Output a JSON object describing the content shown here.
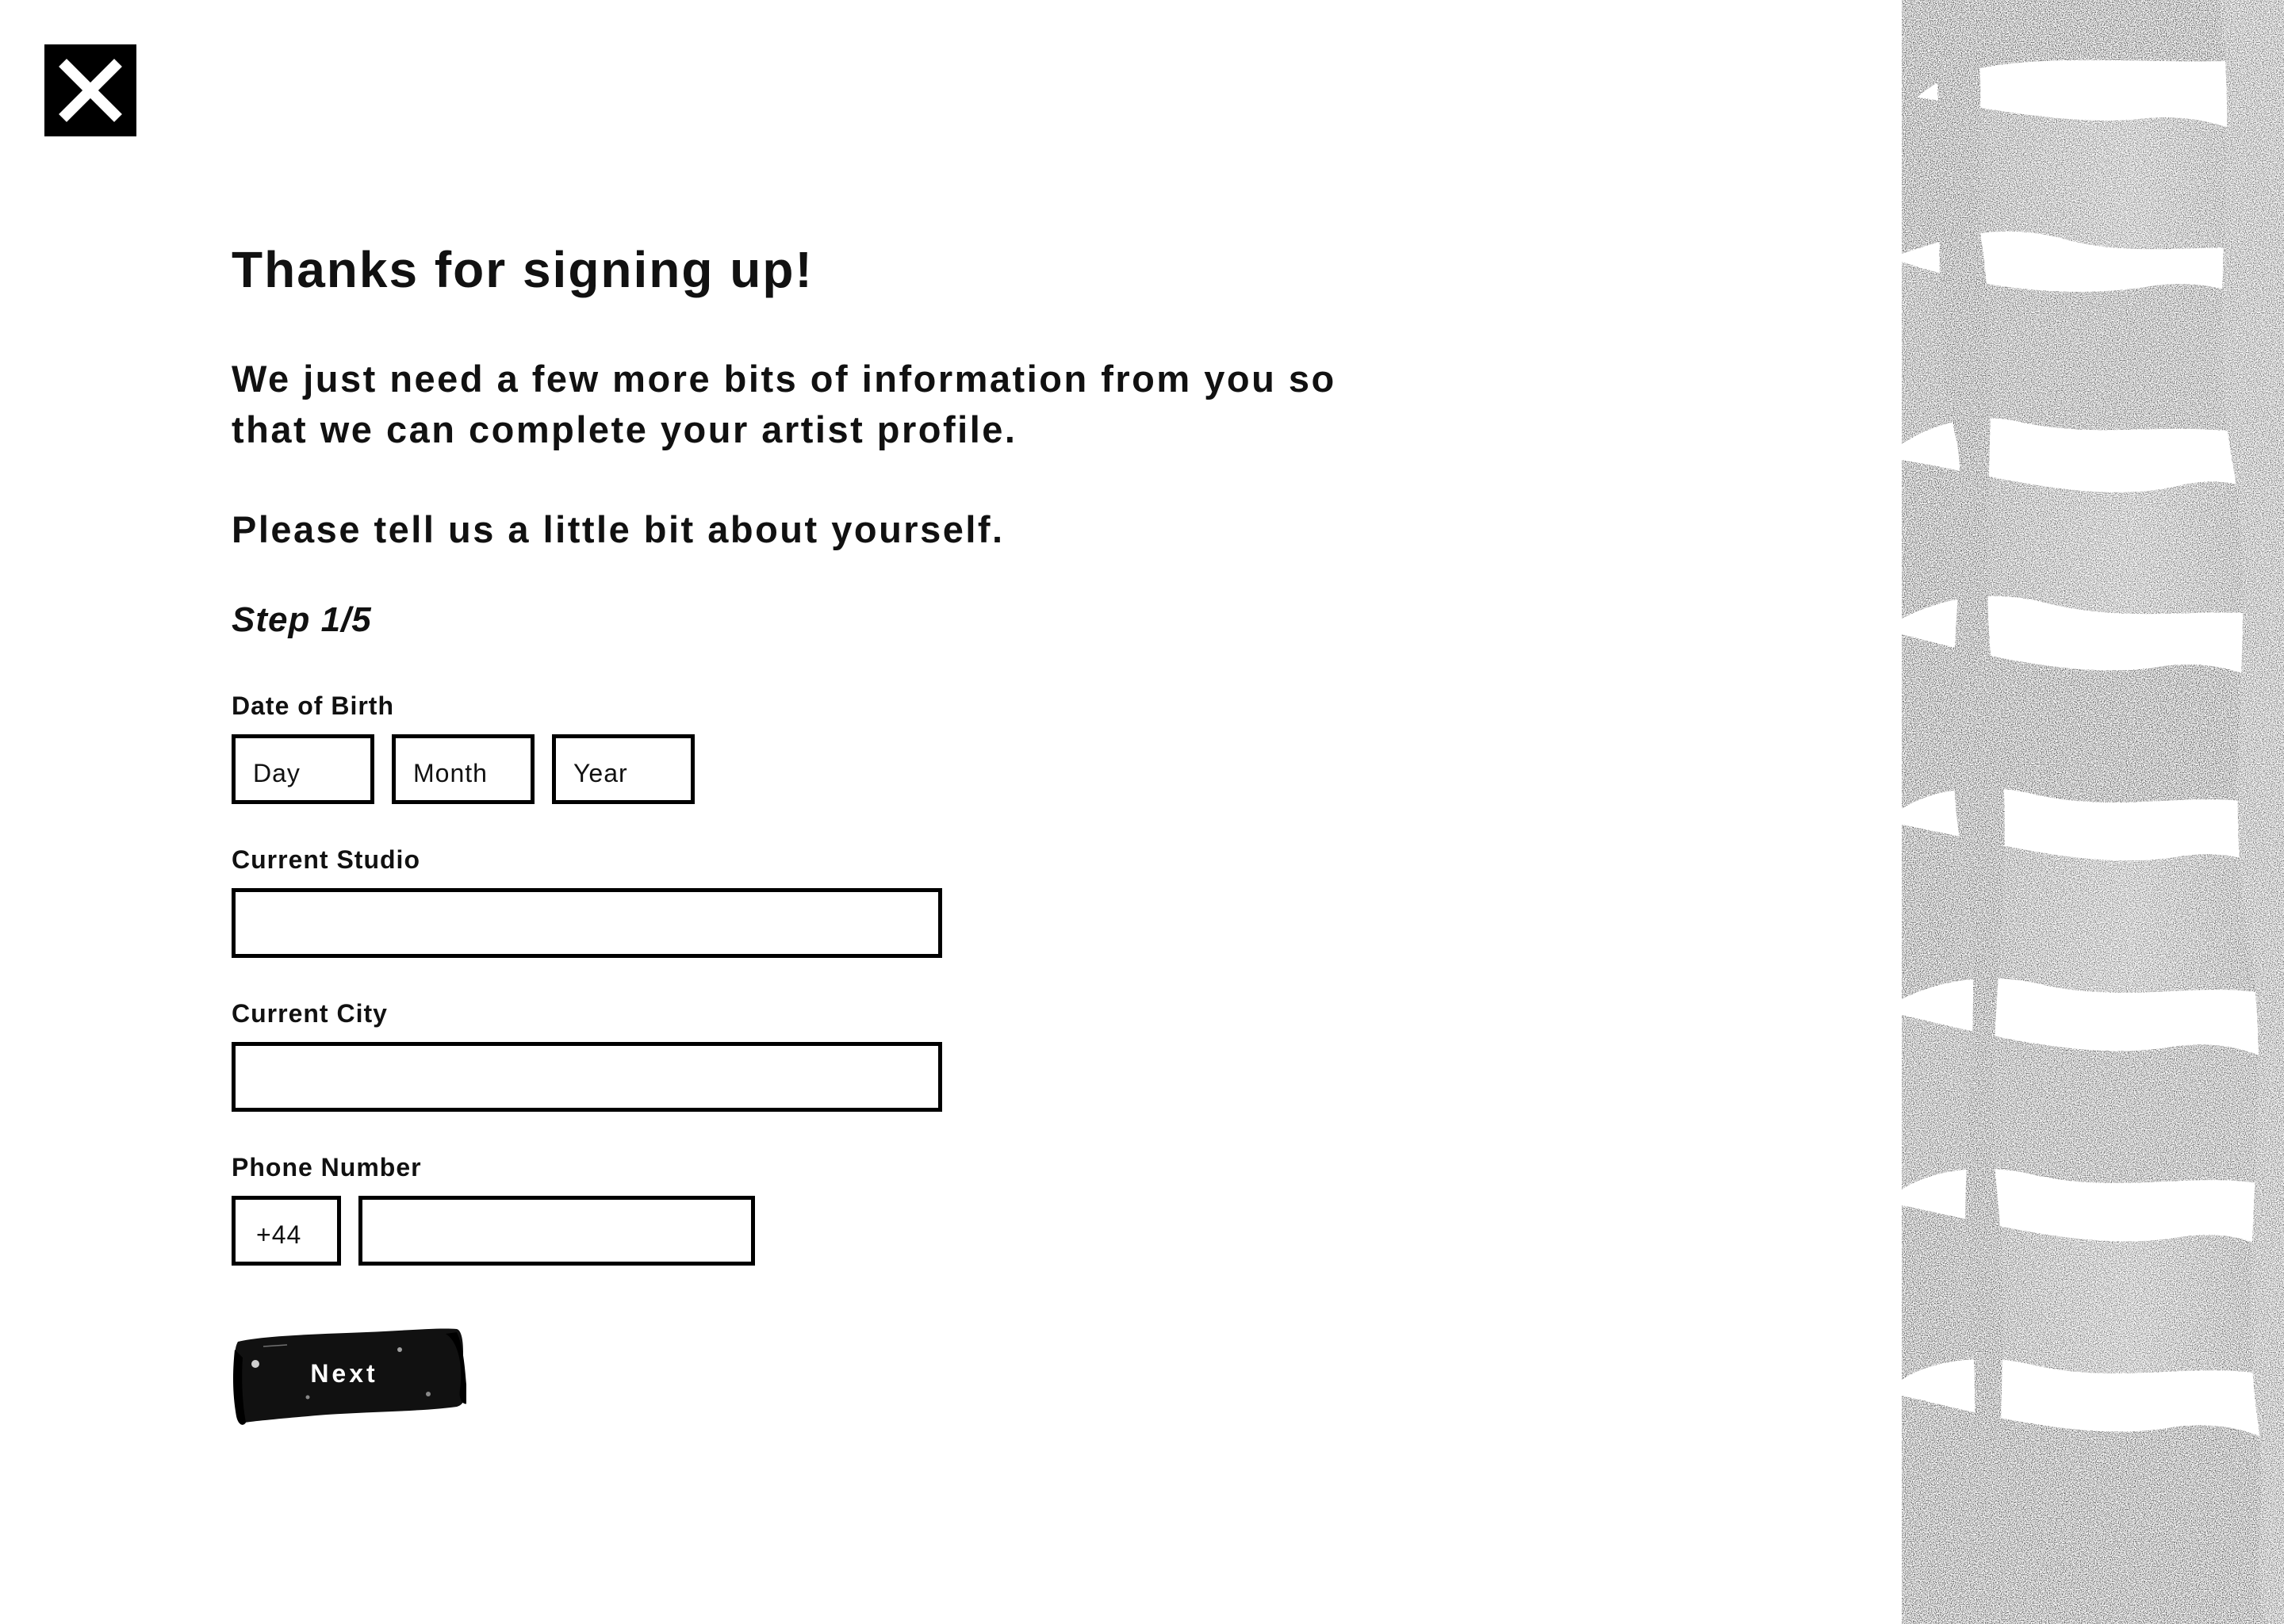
{
  "close": {
    "icon": "close-icon",
    "background_color": "#000000",
    "icon_color": "#ffffff"
  },
  "header": {
    "title": "Thanks for signing up!",
    "intro": "We just need a few more bits of information from you so that we can complete your artist profile.",
    "prompt": "Please tell us a little bit about yourself."
  },
  "step": {
    "label": "Step 1/5"
  },
  "form": {
    "dob": {
      "label": "Date of Birth",
      "day_placeholder": "Day",
      "month_placeholder": "Month",
      "year_placeholder": "Year"
    },
    "studio": {
      "label": "Current Studio",
      "value": ""
    },
    "city": {
      "label": "Current City",
      "value": ""
    },
    "phone": {
      "label": "Phone Number",
      "country_code": "+44",
      "value": ""
    }
  },
  "actions": {
    "next_label": "Next"
  },
  "decoration": {
    "side_art": "stippled-brush-strokes-pattern",
    "colors": [
      "#000000",
      "#ffffff"
    ]
  }
}
